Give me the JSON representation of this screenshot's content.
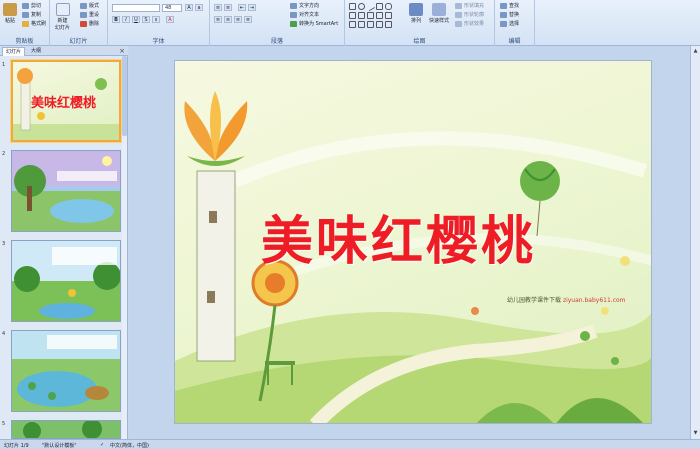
{
  "ribbon": {
    "clipboard": {
      "label": "剪贴板",
      "paste": "粘贴",
      "cut": "剪切",
      "copy": "复制",
      "format_painter": "格式刷"
    },
    "slides": {
      "label": "幻灯片",
      "new_slide": "新建\n幻灯片",
      "layout": "版式",
      "reset": "重设",
      "delete": "删除"
    },
    "font": {
      "label": "字体",
      "font_name": "",
      "font_size": "48"
    },
    "paragraph": {
      "label": "段落",
      "text_direction": "文字方向",
      "align_text": "对齐文本",
      "convert_smartart": "转换为 SmartArt"
    },
    "drawing": {
      "label": "绘图",
      "arrange": "排列",
      "quick_styles": "快速样式",
      "shape_fill": "形状填充",
      "shape_outline": "形状轮廓",
      "shape_effects": "形状效果"
    },
    "editing": {
      "label": "编辑",
      "find": "查找",
      "replace": "替换",
      "select": "选择"
    }
  },
  "left_panel": {
    "tab_slides": "幻灯片",
    "tab_outline": "大纲",
    "close": "×",
    "slide_numbers": [
      "1",
      "2",
      "3",
      "4",
      "5"
    ],
    "thumb1_title": "美味红樱桃"
  },
  "slide": {
    "title": "美味红樱桃",
    "credit_prefix": "幼儿园教学课件下载",
    "credit_url": "ziyuan.baby611.com"
  },
  "status_bar": {
    "slide_count": "幻灯片 1/9",
    "theme": "\"默认设计模板\"",
    "language": "中文(简体，中国)"
  },
  "colors": {
    "title": "#ee1c24",
    "selected_thumb_border": "#f2a93b"
  }
}
